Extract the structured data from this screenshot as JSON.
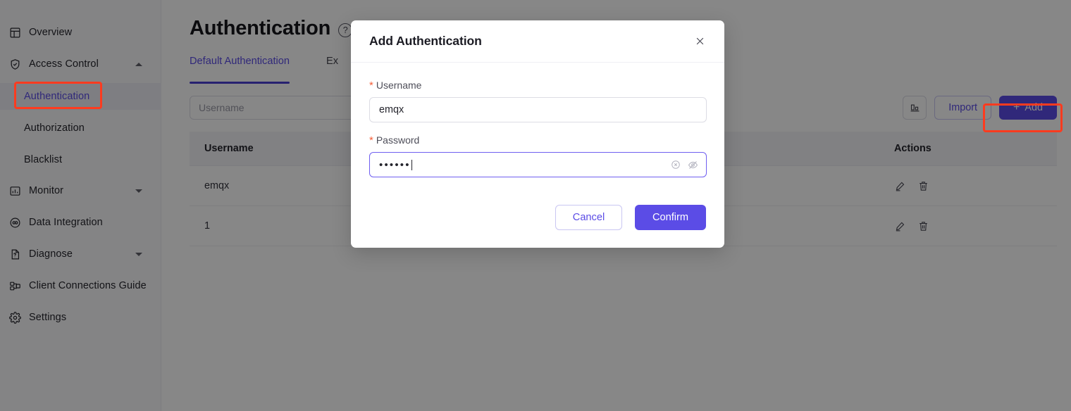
{
  "sidebar": {
    "items": [
      {
        "label": "Overview",
        "icon": "overview-icon",
        "type": "item"
      },
      {
        "label": "Access Control",
        "icon": "shield-icon",
        "type": "group",
        "expanded": true,
        "chevron": "chevron-up-icon"
      },
      {
        "label": "Authentication",
        "type": "sub",
        "active": true
      },
      {
        "label": "Authorization",
        "type": "sub",
        "active": false
      },
      {
        "label": "Blacklist",
        "type": "sub",
        "active": false
      },
      {
        "label": "Monitor",
        "icon": "monitor-icon",
        "type": "group",
        "expanded": false,
        "chevron": "chevron-down-icon"
      },
      {
        "label": "Data Integration",
        "icon": "data-integration-icon",
        "type": "item"
      },
      {
        "label": "Diagnose",
        "icon": "diagnose-icon",
        "type": "group",
        "expanded": false,
        "chevron": "chevron-down-icon"
      },
      {
        "label": "Client Connections Guide",
        "icon": "client-connections-icon",
        "type": "item"
      },
      {
        "label": "Settings",
        "icon": "gear-icon",
        "type": "item"
      }
    ]
  },
  "page": {
    "title": "Authentication",
    "help_icon": "question-mark-icon"
  },
  "tabs": [
    {
      "label": "Default Authentication",
      "active": true
    },
    {
      "label": "Ex",
      "active": false
    }
  ],
  "toolbar": {
    "search_placeholder": "Username",
    "search_value": "",
    "columns_icon": "column-settings-icon",
    "import_label": "Import",
    "add_label": "Add",
    "add_plus_icon": "plus-icon"
  },
  "table": {
    "columns": [
      "Username",
      "",
      "Actions"
    ],
    "rows": [
      {
        "username": "emqx",
        "actions": [
          "edit-icon",
          "delete-icon"
        ]
      },
      {
        "username": "1",
        "actions": [
          "edit-icon",
          "delete-icon"
        ]
      }
    ]
  },
  "modal": {
    "title": "Add Authentication",
    "close_icon": "close-icon",
    "fields": [
      {
        "label": "Username",
        "required_marker": "*",
        "value": "emqx",
        "type": "text"
      },
      {
        "label": "Password",
        "required_marker": "*",
        "value": "••••••",
        "type": "password",
        "focused": true,
        "clear_icon": "circle-close-icon",
        "reveal_icon": "eye-off-icon"
      }
    ],
    "cancel_label": "Cancel",
    "confirm_label": "Confirm"
  },
  "annotations": [
    {
      "target": "sidebar-item-authentication",
      "color": "#fe3b1f"
    },
    {
      "target": "add-button",
      "color": "#fe3b1f"
    }
  ],
  "colors": {
    "accent": "#5b4ce6",
    "accent_dark": "#4a3fd4",
    "annotation": "#fe3b1f",
    "required": "#f5603a",
    "overlay": "rgba(0,0,0,0.47)"
  }
}
